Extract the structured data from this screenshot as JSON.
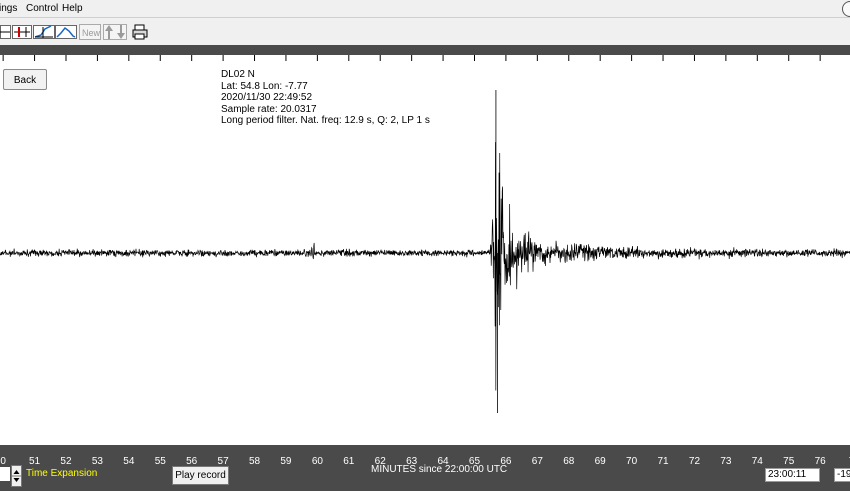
{
  "menu": {
    "items": [
      "ings",
      "Control",
      "Help"
    ]
  },
  "toolbar": {
    "icons": [
      "trace-select-icon",
      "marker-icon",
      "filter-icon",
      "spectrum-icon",
      "new-icon",
      "scale-icon",
      "print-icon"
    ],
    "new_label": "New"
  },
  "back_label": "Back",
  "station": {
    "line1": "DL02  N",
    "line2": "Lat: 54.8 Lon: -7.77",
    "line3": "2020/11/30 22:49:52",
    "line4": "Sample rate: 20.0317",
    "line5": "Long period filter. Nat. freq: 12.9 s, Q: 2, LP 1 s"
  },
  "chart_data": {
    "type": "line",
    "x_ticks": [
      "0",
      "51",
      "52",
      "53",
      "54",
      "55",
      "56",
      "57",
      "58",
      "59",
      "60",
      "61",
      "62",
      "63",
      "64",
      "65",
      "66",
      "67",
      "68",
      "69",
      "70",
      "71",
      "72",
      "73",
      "74",
      "75",
      "76",
      "7"
    ],
    "xlabel": "MINUTES since 22:00:00 UTC",
    "xlim": [
      49.9,
      76.95
    ],
    "event_minute": 65.65,
    "series": [
      {
        "values": []
      }
    ]
  },
  "bottom": {
    "time_expansion_label": "Time Expansion",
    "play_label": "Play record",
    "time_value": "23:00:11",
    "offset_value": "-19"
  },
  "colors": {
    "trace": "#000000",
    "panel": "#4a4a4a",
    "label_yellow": "#ffff00"
  }
}
